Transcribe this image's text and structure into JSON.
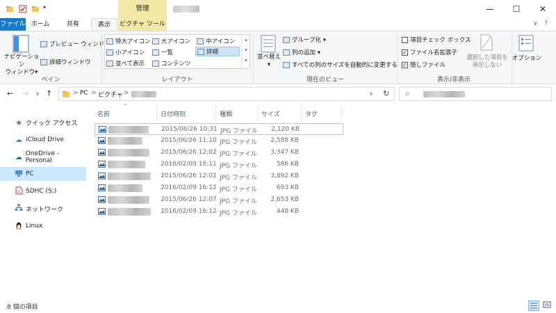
{
  "titlebar": {
    "context_tab_label": "管理",
    "minimize_glyph": "—",
    "maximize_glyph": "☐",
    "close_glyph": "✕"
  },
  "tabs": {
    "file": "ファイル",
    "home": "ホーム",
    "share": "共有",
    "view": "表示",
    "picture_tools": "ピクチャ ツール",
    "collapse_glyph": "∨",
    "help_glyph": "?"
  },
  "ribbon": {
    "pane": {
      "nav_pane": "ナビゲーション",
      "nav_pane2": "ウィンドウ▾",
      "preview": "プレビュー ウィンドウ",
      "details": "詳細ウィンドウ",
      "label": "ペイン"
    },
    "layout": {
      "items": [
        "特大アイコン",
        "大アイコン",
        "中アイコン",
        "小アイコン",
        "一覧",
        "詳細",
        "並べて表示",
        "コンテンツ"
      ],
      "label": "レイアウト"
    },
    "current_view": {
      "sort": "並べ替え",
      "group": "グループ化 ▾",
      "add_col": "列の追加 ▾",
      "autosize": "すべての列のサイズを自動的に変更する",
      "label": "現在のビュー"
    },
    "show_hide": {
      "item_check": "項目チェック ボックス",
      "extensions": "ファイル名拡張子",
      "hidden": "隠しファイル",
      "hide_selected": "選択した項目を",
      "hide_selected2": "表示しない",
      "label": "表示/非表示"
    },
    "options": "オプション"
  },
  "address": {
    "pc": "PC",
    "pictures": "ピクチャ",
    "sep": ">",
    "back": "←",
    "forward": "→",
    "recent": "∨",
    "up": "↑",
    "dropdown": "∨",
    "refresh": "↻",
    "search_glyph": "⌕"
  },
  "nav": [
    {
      "label": "クイック アクセス",
      "icon": "star-icon"
    },
    {
      "label": "iCloud Drive",
      "icon": "cloud-icon"
    },
    {
      "label": "OneDrive - Personal",
      "icon": "onedrive-icon"
    },
    {
      "label": "PC",
      "icon": "pc-icon"
    },
    {
      "label": "SDHC (S:)",
      "icon": "sd-card-icon"
    },
    {
      "label": "ネットワーク",
      "icon": "network-icon"
    },
    {
      "label": "Linux",
      "icon": "linux-icon"
    }
  ],
  "columns": {
    "name": "名前",
    "date": "日付時刻",
    "type": "種類",
    "size": "サイズ",
    "tag": "タグ",
    "sort_glyph": "^"
  },
  "files": [
    {
      "date": "2015/06/26 10:31",
      "type": "JPG ファイル",
      "size": "2,120 KB"
    },
    {
      "date": "2015/06/26 11:10",
      "type": "JPG ファイル",
      "size": "2,588 KB"
    },
    {
      "date": "2015/06/26 12:02",
      "type": "JPG ファイル",
      "size": "3,347 KB"
    },
    {
      "date": "2016/02/09 16:11",
      "type": "JPG ファイル",
      "size": "586 KB"
    },
    {
      "date": "2015/06/26 12:02",
      "type": "JPG ファイル",
      "size": "3,892 KB"
    },
    {
      "date": "2016/02/09 16:12",
      "type": "JPG ファイル",
      "size": "693 KB"
    },
    {
      "date": "2015/06/26 12:07",
      "type": "JPG ファイル",
      "size": "2,653 KB"
    },
    {
      "date": "2016/02/09 16:12",
      "type": "JPG ファイル",
      "size": "448 KB"
    }
  ],
  "status": {
    "count": "8 個の項目"
  },
  "colors": {
    "file_tab": "#1979ca",
    "context_tab": "#f3e9a6",
    "nav_selected": "#cce8ff"
  }
}
